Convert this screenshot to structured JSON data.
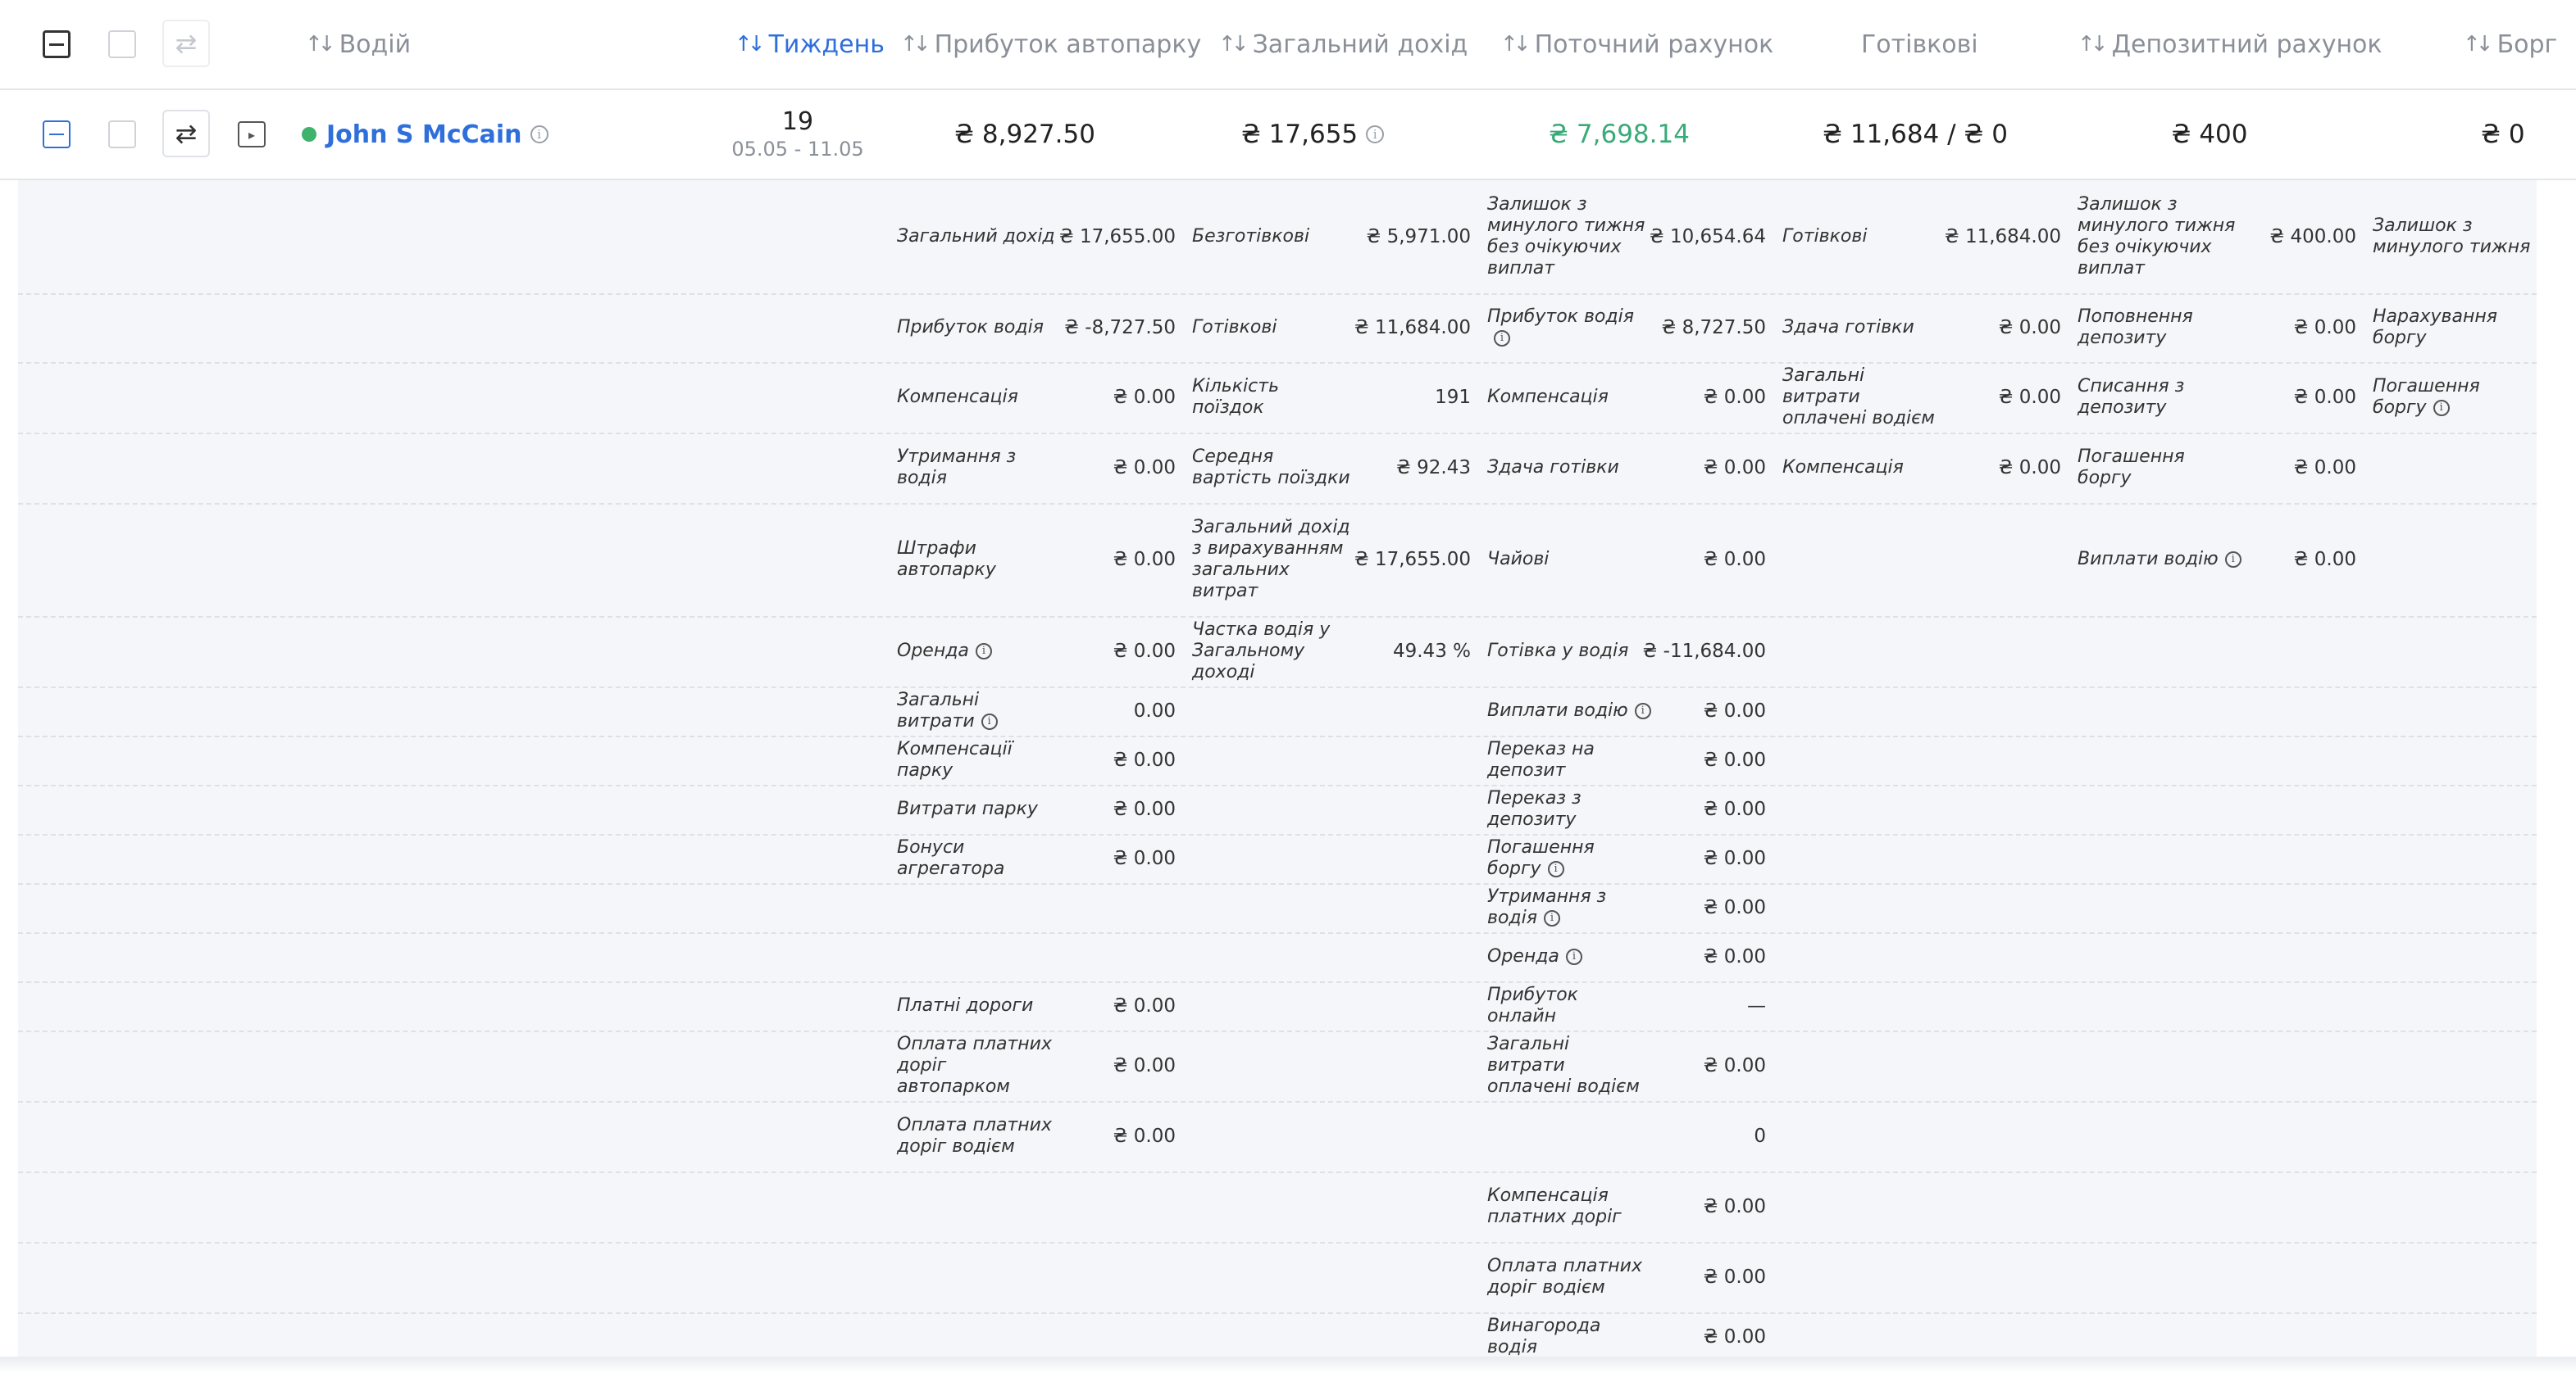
{
  "header": {
    "driver": "Водій",
    "week": "Тиждень",
    "fleet_profit": "Прибуток автопарку",
    "total_income": "Загальний дохід",
    "current_account": "Поточний рахунок",
    "cash": "Готівкові",
    "deposit_account": "Депозитний рахунок",
    "debt": "Борг"
  },
  "row": {
    "driver_name": "John S McCain",
    "week_number": "19",
    "week_dates": "05.05 - 11.05",
    "fleet_profit": "₴ 8,927.50",
    "total_income": "₴ 17,655",
    "current_account": "₴ 7,698.14",
    "cash": "₴ 11,684  /  ₴ 0",
    "deposit": "₴ 400",
    "debt": "₴ 0"
  },
  "colors": {
    "accent": "#2f6fdb",
    "positive": "#3aaa78",
    "status_online": "#3fb26b"
  },
  "details": {
    "col1": [
      {
        "label": "Загальний дохід",
        "value": "₴ 17,655.00"
      },
      {
        "label": "Прибуток водія",
        "value": "₴ -8,727.50"
      },
      {
        "label": "Компенсація",
        "value": "₴ 0.00"
      },
      {
        "label": "Утримання з водія",
        "value": "₴ 0.00"
      },
      {
        "label": "Штрафи автопарку",
        "value": "₴ 0.00"
      },
      {
        "label": "Оренда",
        "value": "₴ 0.00",
        "info": true
      },
      {
        "label": "Загальні витрати",
        "value": "0.00",
        "info": true
      },
      {
        "label": "Компенсації парку",
        "value": "₴ 0.00"
      },
      {
        "label": "Витрати парку",
        "value": "₴ 0.00"
      },
      {
        "label": "Бонуси агрегатора",
        "value": "₴ 0.00"
      },
      {
        "label": "",
        "value": ""
      },
      {
        "label": "",
        "value": ""
      },
      {
        "label": "Платні дороги",
        "value": "₴ 0.00"
      },
      {
        "label": "Оплата платних доріг автопарком",
        "value": "₴ 0.00"
      },
      {
        "label": "Оплата платних доріг водієм",
        "value": "₴ 0.00"
      }
    ],
    "col2": [
      {
        "label": "Безготівкові",
        "value": "₴ 5,971.00"
      },
      {
        "label": "Готівкові",
        "value": "₴ 11,684.00"
      },
      {
        "label": "Кількість поїздок",
        "value": "191"
      },
      {
        "label": "Середня вартість поїздки",
        "value": "₴ 92.43"
      },
      {
        "label": "Загальний дохід з вирахуванням загальних витрат",
        "value": "₴ 17,655.00"
      },
      {
        "label": "Частка водія у Загальному доході",
        "value": "49.43 %"
      }
    ],
    "col3": [
      {
        "label": "Залишок з минулого тижня без очікуючих виплат",
        "value": "₴ 10,654.64"
      },
      {
        "label": "Прибуток водія",
        "value": "₴ 8,727.50",
        "info": true
      },
      {
        "label": "Компенсація",
        "value": "₴ 0.00"
      },
      {
        "label": "Здача готівки",
        "value": "₴ 0.00"
      },
      {
        "label": "Чайові",
        "value": "₴ 0.00"
      },
      {
        "label": "Готівка у водія",
        "value": "₴ -11,684.00"
      },
      {
        "label": "Виплати водію",
        "value": "₴ 0.00",
        "info": true
      },
      {
        "label": "Переказ на депозит",
        "value": "₴ 0.00"
      },
      {
        "label": "Переказ з депозиту",
        "value": "₴ 0.00"
      },
      {
        "label": "Погашення боргу",
        "value": "₴ 0.00",
        "info": true
      },
      {
        "label": "Утримання з водія",
        "value": "₴ 0.00",
        "info": true
      },
      {
        "label": "Оренда",
        "value": "₴ 0.00",
        "info": true
      },
      {
        "label": "Прибуток онлайн",
        "value": "—"
      },
      {
        "label": "Загальні витрати оплачені водієм",
        "value": "₴ 0.00"
      },
      {
        "label": "",
        "value": "0"
      },
      {
        "label": "Компенсація платних доріг",
        "value": "₴ 0.00"
      },
      {
        "label": "Оплата платних доріг водієм",
        "value": "₴ 0.00"
      },
      {
        "label": "Винагорода водія",
        "value": "₴ 0.00"
      }
    ],
    "col4": [
      {
        "label": "Готівкові",
        "value": "₴ 11,684.00"
      },
      {
        "label": "Здача готівки",
        "value": "₴ 0.00"
      },
      {
        "label": "Загальні витрати оплачені водієм",
        "value": "₴ 0.00"
      },
      {
        "label": "Компенсація",
        "value": "₴ 0.00"
      }
    ],
    "col5": [
      {
        "label": "Залишок з минулого тижня без очікуючих виплат",
        "value": "₴ 400.00"
      },
      {
        "label": "Поповнення депозиту",
        "value": "₴ 0.00"
      },
      {
        "label": "Списання з депозиту",
        "value": "₴ 0.00"
      },
      {
        "label": "Погашення боргу",
        "value": "₴ 0.00"
      },
      {
        "label": "Виплати водію",
        "value": "₴ 0.00",
        "info": true
      }
    ],
    "col6": [
      {
        "label": "Залишок з минулого тижня",
        "value": ""
      },
      {
        "label": "Нарахування боргу",
        "value": ""
      },
      {
        "label": "Погашення боргу",
        "value": "",
        "info": true
      }
    ]
  }
}
